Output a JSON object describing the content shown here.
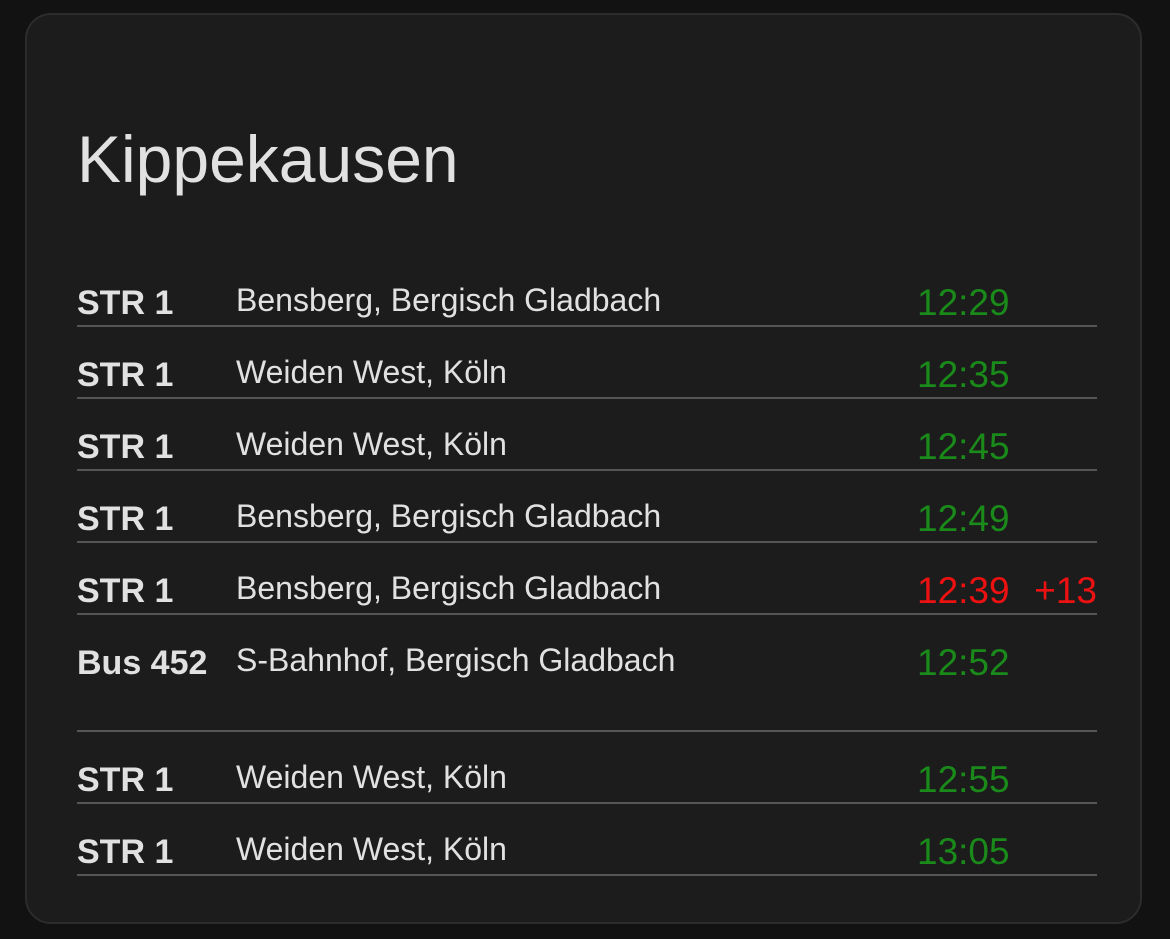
{
  "card": {
    "title": "Kippekausen"
  },
  "colors": {
    "on_time": "#1a8a1a",
    "delayed": "#ee1111",
    "text": "#e1e1e1",
    "divider": "#555555",
    "card_background": "#1c1c1c"
  },
  "departures": [
    {
      "line": "STR 1",
      "destination": "Bensberg, Bergisch Gladbach",
      "time": "12:29",
      "delay": "",
      "status": "on_time"
    },
    {
      "line": "STR 1",
      "destination": "Weiden West, Köln",
      "time": "12:35",
      "delay": "",
      "status": "on_time"
    },
    {
      "line": "STR 1",
      "destination": "Weiden West, Köln",
      "time": "12:45",
      "delay": "",
      "status": "on_time"
    },
    {
      "line": "STR 1",
      "destination": "Bensberg, Bergisch Gladbach",
      "time": "12:49",
      "delay": "",
      "status": "on_time"
    },
    {
      "line": "STR 1",
      "destination": "Bensberg, Bergisch Gladbach",
      "time": "12:39",
      "delay": "+13",
      "status": "delayed"
    },
    {
      "line": "Bus 452",
      "destination": "S-Bahnhof, Bergisch Gladbach",
      "time": "12:52",
      "delay": "",
      "status": "on_time"
    },
    {
      "line": "STR 1",
      "destination": "Weiden West, Köln",
      "time": "12:55",
      "delay": "",
      "status": "on_time"
    },
    {
      "line": "STR 1",
      "destination": "Weiden West, Köln",
      "time": "13:05",
      "delay": "",
      "status": "on_time"
    }
  ]
}
